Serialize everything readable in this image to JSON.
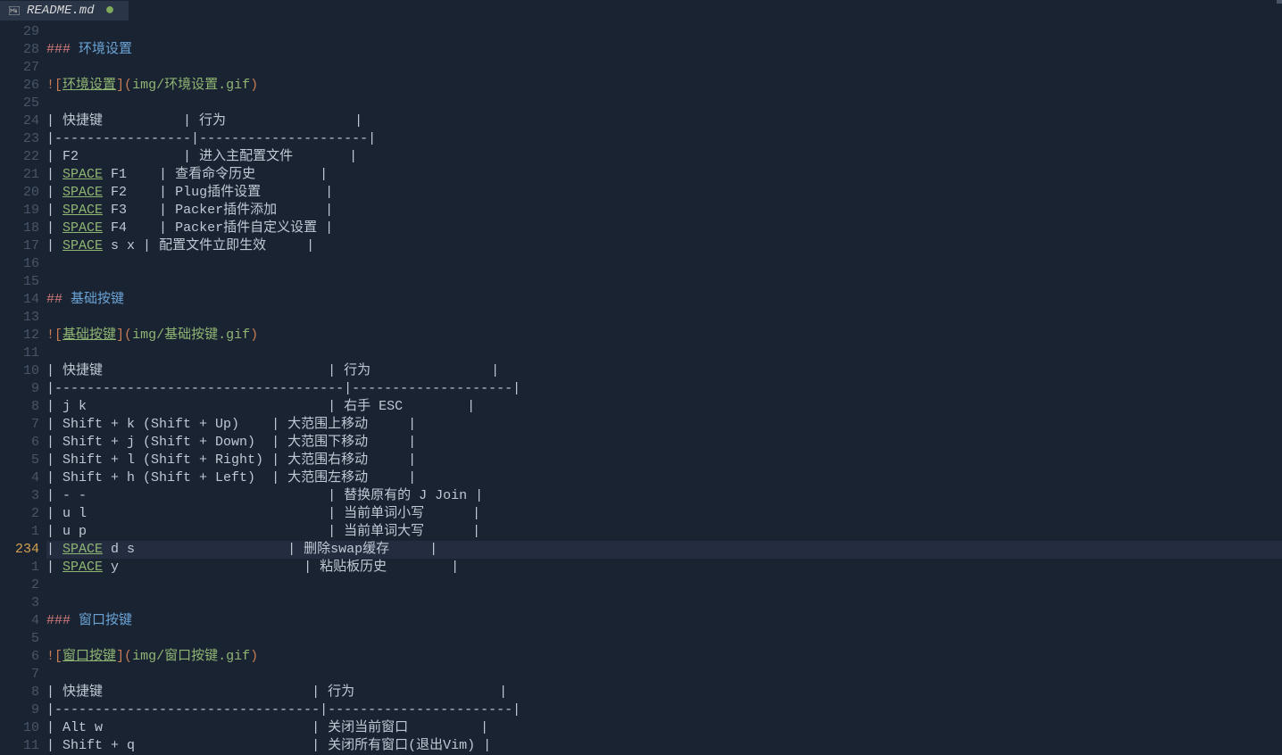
{
  "tab": {
    "filename": "README.md",
    "modified_indicator": "●"
  },
  "cursor_line_display": "234",
  "gutter": [
    "29",
    "28",
    "27",
    "26",
    "25",
    "24",
    "23",
    "22",
    "21",
    "20",
    "19",
    "18",
    "17",
    "16",
    "15",
    "14",
    "13",
    "12",
    "11",
    "10",
    "9",
    "8",
    "7",
    "6",
    "5",
    "4",
    "3",
    "2",
    "1",
    "234",
    "1",
    "2",
    "3",
    "4",
    "5",
    "6",
    "7",
    "8",
    "9",
    "10",
    "11"
  ],
  "lines": [
    {
      "type": "blank"
    },
    {
      "type": "heading",
      "level": 3,
      "text": "环境设置"
    },
    {
      "type": "blank"
    },
    {
      "type": "imglink",
      "alt": "环境设置",
      "url": "img/环境设置.gif"
    },
    {
      "type": "blank"
    },
    {
      "type": "raw",
      "segs": [
        {
          "c": "pipe",
          "t": "| "
        },
        {
          "c": "txt",
          "t": "快捷键          "
        },
        {
          "c": "pipe",
          "t": "| "
        },
        {
          "c": "txt",
          "t": "行为                "
        },
        {
          "c": "pipe",
          "t": "|"
        }
      ]
    },
    {
      "type": "raw",
      "segs": [
        {
          "c": "pipe",
          "t": "|"
        },
        {
          "c": "dash",
          "t": "-----------------"
        },
        {
          "c": "pipe",
          "t": "|"
        },
        {
          "c": "dash",
          "t": "---------------------"
        },
        {
          "c": "pipe",
          "t": "|"
        }
      ]
    },
    {
      "type": "raw",
      "segs": [
        {
          "c": "pipe",
          "t": "| "
        },
        {
          "c": "txt",
          "t": "F2             "
        },
        {
          "c": "pipe",
          "t": "| "
        },
        {
          "c": "txt",
          "t": "进入主配置文件       "
        },
        {
          "c": "pipe",
          "t": "|"
        }
      ]
    },
    {
      "type": "raw",
      "segs": [
        {
          "c": "pipe",
          "t": "| "
        },
        {
          "c": "kbd-space",
          "t": "SPACE"
        },
        {
          "c": "txt",
          "t": " F1    "
        },
        {
          "c": "pipe",
          "t": "| "
        },
        {
          "c": "txt",
          "t": "查看命令历史        "
        },
        {
          "c": "pipe",
          "t": "|"
        }
      ]
    },
    {
      "type": "raw",
      "segs": [
        {
          "c": "pipe",
          "t": "| "
        },
        {
          "c": "kbd-space",
          "t": "SPACE"
        },
        {
          "c": "txt",
          "t": " F2    "
        },
        {
          "c": "pipe",
          "t": "| "
        },
        {
          "c": "txt",
          "t": "Plug插件设置        "
        },
        {
          "c": "pipe",
          "t": "|"
        }
      ]
    },
    {
      "type": "raw",
      "segs": [
        {
          "c": "pipe",
          "t": "| "
        },
        {
          "c": "kbd-space",
          "t": "SPACE"
        },
        {
          "c": "txt",
          "t": " F3    "
        },
        {
          "c": "pipe",
          "t": "| "
        },
        {
          "c": "txt",
          "t": "Packer插件添加      "
        },
        {
          "c": "pipe",
          "t": "|"
        }
      ]
    },
    {
      "type": "raw",
      "segs": [
        {
          "c": "pipe",
          "t": "| "
        },
        {
          "c": "kbd-space",
          "t": "SPACE"
        },
        {
          "c": "txt",
          "t": " F4    "
        },
        {
          "c": "pipe",
          "t": "| "
        },
        {
          "c": "txt",
          "t": "Packer插件自定义设置 "
        },
        {
          "c": "pipe",
          "t": "|"
        }
      ]
    },
    {
      "type": "raw",
      "segs": [
        {
          "c": "pipe",
          "t": "| "
        },
        {
          "c": "kbd-space",
          "t": "SPACE"
        },
        {
          "c": "txt",
          "t": " s x "
        },
        {
          "c": "pipe",
          "t": "| "
        },
        {
          "c": "txt",
          "t": "配置文件立即生效     "
        },
        {
          "c": "pipe",
          "t": "|"
        }
      ]
    },
    {
      "type": "blank"
    },
    {
      "type": "blank"
    },
    {
      "type": "heading",
      "level": 2,
      "text": "基础按键"
    },
    {
      "type": "blank"
    },
    {
      "type": "imglink",
      "alt": "基础按键",
      "url": "img/基础按键.gif"
    },
    {
      "type": "blank"
    },
    {
      "type": "raw",
      "segs": [
        {
          "c": "pipe",
          "t": "| "
        },
        {
          "c": "txt",
          "t": "快捷键                            "
        },
        {
          "c": "pipe",
          "t": "| "
        },
        {
          "c": "txt",
          "t": "行为               "
        },
        {
          "c": "pipe",
          "t": "|"
        }
      ]
    },
    {
      "type": "raw",
      "segs": [
        {
          "c": "pipe",
          "t": "|"
        },
        {
          "c": "dash",
          "t": "------------------------------------"
        },
        {
          "c": "pipe",
          "t": "|"
        },
        {
          "c": "dash",
          "t": "--------------------"
        },
        {
          "c": "pipe",
          "t": "|"
        }
      ]
    },
    {
      "type": "raw",
      "segs": [
        {
          "c": "pipe",
          "t": "| "
        },
        {
          "c": "txt",
          "t": "j k                              "
        },
        {
          "c": "pipe",
          "t": "| "
        },
        {
          "c": "txt",
          "t": "右手 ESC        "
        },
        {
          "c": "pipe",
          "t": "|"
        }
      ]
    },
    {
      "type": "raw",
      "segs": [
        {
          "c": "pipe",
          "t": "| "
        },
        {
          "c": "txt",
          "t": "Shift + k (Shift + Up)    "
        },
        {
          "c": "pipe",
          "t": "| "
        },
        {
          "c": "txt",
          "t": "大范围上移动     "
        },
        {
          "c": "pipe",
          "t": "|"
        }
      ]
    },
    {
      "type": "raw",
      "segs": [
        {
          "c": "pipe",
          "t": "| "
        },
        {
          "c": "txt",
          "t": "Shift + j (Shift + Down)  "
        },
        {
          "c": "pipe",
          "t": "| "
        },
        {
          "c": "txt",
          "t": "大范围下移动     "
        },
        {
          "c": "pipe",
          "t": "|"
        }
      ]
    },
    {
      "type": "raw",
      "segs": [
        {
          "c": "pipe",
          "t": "| "
        },
        {
          "c": "txt",
          "t": "Shift + l (Shift + Right) "
        },
        {
          "c": "pipe",
          "t": "| "
        },
        {
          "c": "txt",
          "t": "大范围右移动     "
        },
        {
          "c": "pipe",
          "t": "|"
        }
      ]
    },
    {
      "type": "raw",
      "segs": [
        {
          "c": "pipe",
          "t": "| "
        },
        {
          "c": "txt",
          "t": "Shift + h (Shift + Left)  "
        },
        {
          "c": "pipe",
          "t": "| "
        },
        {
          "c": "txt",
          "t": "大范围左移动     "
        },
        {
          "c": "pipe",
          "t": "|"
        }
      ]
    },
    {
      "type": "raw",
      "segs": [
        {
          "c": "pipe",
          "t": "| "
        },
        {
          "c": "txt",
          "t": "- -                              "
        },
        {
          "c": "pipe",
          "t": "| "
        },
        {
          "c": "txt",
          "t": "替换原有的 J Join "
        },
        {
          "c": "pipe",
          "t": "|"
        }
      ]
    },
    {
      "type": "raw",
      "segs": [
        {
          "c": "pipe",
          "t": "| "
        },
        {
          "c": "txt",
          "t": "u l                              "
        },
        {
          "c": "pipe",
          "t": "| "
        },
        {
          "c": "txt",
          "t": "当前单词小写      "
        },
        {
          "c": "pipe",
          "t": "|"
        }
      ]
    },
    {
      "type": "raw",
      "segs": [
        {
          "c": "pipe",
          "t": "| "
        },
        {
          "c": "txt",
          "t": "u p                              "
        },
        {
          "c": "pipe",
          "t": "| "
        },
        {
          "c": "txt",
          "t": "当前单词大写      "
        },
        {
          "c": "pipe",
          "t": "|"
        }
      ]
    },
    {
      "type": "raw",
      "current": true,
      "segs": [
        {
          "c": "pipe",
          "t": "| "
        },
        {
          "c": "kbd-space",
          "t": "SPACE"
        },
        {
          "c": "txt",
          "t": " d s                   "
        },
        {
          "c": "pipe",
          "t": "| "
        },
        {
          "c": "txt",
          "t": "删除swap缓存     "
        },
        {
          "c": "pipe",
          "t": "|"
        }
      ]
    },
    {
      "type": "raw",
      "segs": [
        {
          "c": "pipe",
          "t": "| "
        },
        {
          "c": "kbd-space",
          "t": "SPACE"
        },
        {
          "c": "txt",
          "t": " y                       "
        },
        {
          "c": "pipe",
          "t": "| "
        },
        {
          "c": "txt",
          "t": "粘贴板历史        "
        },
        {
          "c": "pipe",
          "t": "|"
        }
      ]
    },
    {
      "type": "blank"
    },
    {
      "type": "blank"
    },
    {
      "type": "heading",
      "level": 3,
      "text": "窗口按键"
    },
    {
      "type": "blank"
    },
    {
      "type": "imglink",
      "alt": "窗口按键",
      "url": "img/窗口按键.gif"
    },
    {
      "type": "blank"
    },
    {
      "type": "raw",
      "segs": [
        {
          "c": "pipe",
          "t": "| "
        },
        {
          "c": "txt",
          "t": "快捷键                          "
        },
        {
          "c": "pipe",
          "t": "| "
        },
        {
          "c": "txt",
          "t": "行为                  "
        },
        {
          "c": "pipe",
          "t": "|"
        }
      ]
    },
    {
      "type": "raw",
      "segs": [
        {
          "c": "pipe",
          "t": "|"
        },
        {
          "c": "dash",
          "t": "---------------------------------"
        },
        {
          "c": "pipe",
          "t": "|"
        },
        {
          "c": "dash",
          "t": "-----------------------"
        },
        {
          "c": "pipe",
          "t": "|"
        }
      ]
    },
    {
      "type": "raw",
      "segs": [
        {
          "c": "pipe",
          "t": "| "
        },
        {
          "c": "txt",
          "t": "Alt w                          "
        },
        {
          "c": "pipe",
          "t": "| "
        },
        {
          "c": "txt",
          "t": "关闭当前窗口         "
        },
        {
          "c": "pipe",
          "t": "|"
        }
      ]
    },
    {
      "type": "raw",
      "segs": [
        {
          "c": "pipe",
          "t": "| "
        },
        {
          "c": "txt",
          "t": "Shift + q                      "
        },
        {
          "c": "pipe",
          "t": "| "
        },
        {
          "c": "txt",
          "t": "关闭所有窗口(退出Vim) "
        },
        {
          "c": "pipe",
          "t": "|"
        }
      ]
    }
  ]
}
